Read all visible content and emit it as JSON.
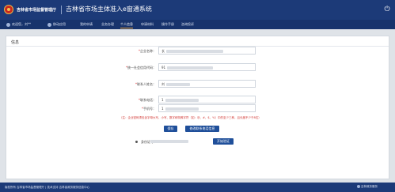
{
  "header": {
    "agency": "吉林省市场监督管理厅",
    "system_title": "吉林省市场主体准入e窗通系统",
    "logout_icon": "power-icon"
  },
  "nav": {
    "items": [
      {
        "label": "欢迎您，刘**",
        "icon": "user-icon",
        "active": false
      },
      {
        "label": "移动应用",
        "icon": "mobile-icon",
        "active": false
      },
      {
        "label": "我的申请",
        "icon": "",
        "active": false
      },
      {
        "label": "业务办理",
        "icon": "",
        "active": false
      },
      {
        "label": "个人信息",
        "icon": "",
        "active": true
      },
      {
        "label": "申请材料",
        "icon": "",
        "active": false
      },
      {
        "label": "操作手册",
        "icon": "",
        "active": false
      },
      {
        "label": "咨询投诉",
        "icon": "",
        "active": false
      }
    ]
  },
  "panel": {
    "title": "信息",
    "fields": [
      {
        "label": "企业名称：",
        "required": true,
        "value": "长"
      },
      {
        "label": "统一社会信用代码：",
        "required": true,
        "value": "91"
      },
      {
        "label": "联系人姓名：",
        "required": true,
        "value": "刘"
      },
      {
        "label": "联系电话：",
        "required": true,
        "value": "1"
      },
      {
        "label": "手机号：",
        "required": true,
        "value": "1"
      }
    ],
    "tip": "（注：企业密码须包含字母大写、小写、数字和特殊字符（如：@、#、$、%）中的至少三种，且长度不少于8位）",
    "buttons": {
      "save": "保存",
      "modify_phone": "修改联系电话信息"
    },
    "id_label": "身份证号：",
    "start_button": "开始验证"
  },
  "footer": {
    "text": "版权所有 吉林省市场监督管理厅 | 技术支持 吉林省政务服务信息中心",
    "right": "吉林政务服务"
  },
  "colors": {
    "header_bg": "#1c3a78",
    "nav_bg": "#17336c",
    "accent": "#e8a33c",
    "button": "#1f4f9a",
    "warning": "#d0312d"
  }
}
